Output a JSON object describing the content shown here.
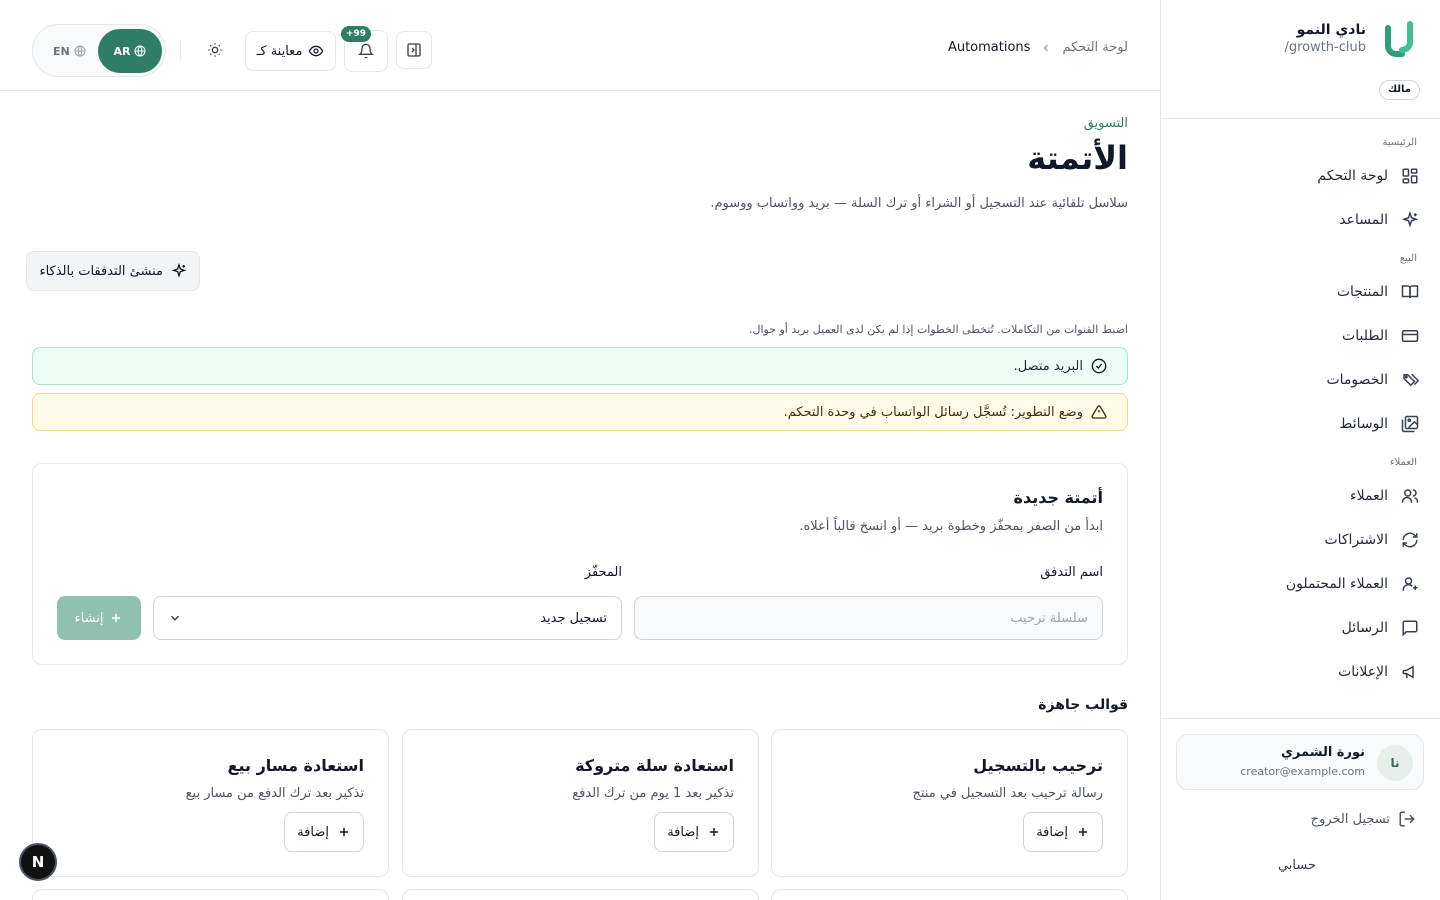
{
  "brand": {
    "name": "نادي النمو",
    "slug": "/growth-club",
    "role": "مالك"
  },
  "sidebar": {
    "groups": [
      {
        "label": "الرئيسية",
        "items": [
          {
            "label": "لوحة التحكم",
            "icon": "dashboard-grid-icon"
          },
          {
            "label": "المساعد",
            "icon": "sparkles-icon"
          }
        ]
      },
      {
        "label": "البيع",
        "items": [
          {
            "label": "المنتجات",
            "icon": "book-open-icon"
          },
          {
            "label": "الطلبات",
            "icon": "credit-card-icon"
          },
          {
            "label": "الخصومات",
            "icon": "tags-icon"
          },
          {
            "label": "الوسائط",
            "icon": "images-icon"
          }
        ]
      },
      {
        "label": "العملاء",
        "items": [
          {
            "label": "العملاء",
            "icon": "users-icon"
          },
          {
            "label": "الاشتراكات",
            "icon": "refresh-icon"
          },
          {
            "label": "العملاء المحتملون",
            "icon": "user-plus-icon"
          },
          {
            "label": "الرسائل",
            "icon": "message-square-icon"
          },
          {
            "label": "الإعلانات",
            "icon": "megaphone-icon"
          }
        ]
      }
    ],
    "user": {
      "initials": "نا",
      "name": "نورة الشمري",
      "email": "creator@example.com"
    },
    "logout_label": "تسجيل الخروج",
    "account_label": "حسابي"
  },
  "topbar": {
    "breadcrumb_root": "لوحة التحكم",
    "breadcrumb_current": "Automations",
    "lang_ar": "AR",
    "lang_en": "EN",
    "preview_label": "معاينة كـ",
    "notifications_badge": "+99"
  },
  "page": {
    "eyebrow": "التسويق",
    "title": "الأتمتة",
    "description": "سلاسل تلقائية عند التسجيل أو الشراء أو ترك السلة — بريد وواتساب ووسوم.",
    "ai_builder_label": "منشئ التدفقات بالذكاء",
    "channels_note": "اضبط القنوات من التكاملات. تُتخطى الخطوات إذا لم يكن لدى العميل بريد أو جوال.",
    "alert_success": "البريد متصل.",
    "alert_warning": "وضع التطوير: تُسجَّل رسائل الواتساب في وحدة التحكم."
  },
  "new_automation": {
    "title": "أتمتة جديدة",
    "description": "ابدأ من الصفر بمحفّز وخطوة بريد — أو انسخ قالباً أعلاه.",
    "name_label": "اسم التدفق",
    "name_placeholder": "سلسلة ترحيب",
    "name_value": "",
    "trigger_label": "المحفّز",
    "trigger_value": "تسجيل جديد",
    "create_label": "إنشاء"
  },
  "templates": {
    "heading": "قوالب جاهزة",
    "items": [
      {
        "title": "ترحيب بالتسجيل",
        "description": "رسالة ترحيب بعد التسجيل في منتج",
        "add_label": "إضافة"
      },
      {
        "title": "استعادة سلة متروكة",
        "description": "تذكير بعد 1 يوم من ترك الدفع",
        "add_label": "إضافة"
      },
      {
        "title": "استعادة مسار بيع",
        "description": "تذكير بعد ترك الدفع من مسار بيع",
        "add_label": "إضافة"
      }
    ]
  },
  "devtools": {
    "badge": "N"
  },
  "colors": {
    "accent": "#2f7d67",
    "success_bg": "#ecfdf5",
    "warning_bg": "#fefce8"
  }
}
